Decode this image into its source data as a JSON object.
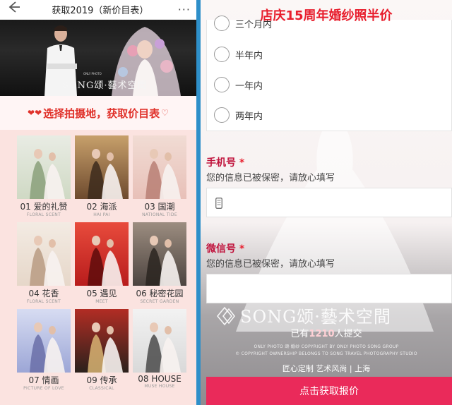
{
  "left": {
    "topbar": {
      "back_icon": "back-arrow-icon",
      "title": "获取2019（新价目表）",
      "more_icon": "more-dots-icon",
      "more_glyph": "···"
    },
    "banner": {
      "brand": "SONG颂·藝术空間",
      "brand_small": "ONLY PHOTO"
    },
    "headline": {
      "text": "选择拍摄地，获取价目表",
      "left_icon": "double-heart-icon",
      "right_icon": "heart-icon"
    },
    "locations": [
      {
        "num": "01",
        "name": "爱的礼赞",
        "en": "FLORAL SCENT",
        "colors": [
          "#cfd9c4",
          "#e9ece4",
          "#8aa07a"
        ]
      },
      {
        "num": "02",
        "name": "海派",
        "en": "HAI PAI",
        "colors": [
          "#6e4a2e",
          "#c7a06b",
          "#3c2a1c"
        ]
      },
      {
        "num": "03",
        "name": "国潮",
        "en": "NATIONAL TIDE",
        "colors": [
          "#e8c0b8",
          "#f1dcd4",
          "#b97f74"
        ]
      },
      {
        "num": "04",
        "name": "花香",
        "en": "FLORAL SCENT",
        "colors": [
          "#e6d7c9",
          "#f3ebe3",
          "#b99b83"
        ]
      },
      {
        "num": "05",
        "name": "遇见",
        "en": "MEET",
        "colors": [
          "#b81c1c",
          "#e84b3c",
          "#5e0c0c"
        ]
      },
      {
        "num": "06",
        "name": "秘密花园",
        "en": "SECRET GARDEN",
        "colors": [
          "#4d4440",
          "#9c8d80",
          "#2a2420"
        ]
      },
      {
        "num": "07",
        "name": "情画",
        "en": "PICTURE OF LOVE",
        "colors": [
          "#9ca6d6",
          "#d7dcf2",
          "#6a6fa8"
        ]
      },
      {
        "num": "09",
        "name": "传承",
        "en": "CLASSICAL",
        "colors": [
          "#2b211c",
          "#b22d24",
          "#d8b473"
        ]
      },
      {
        "num": "08",
        "name": "HOUSE",
        "en": "MUSE HOUSE",
        "colors": [
          "#d9d9d9",
          "#f2f2f2",
          "#4a4a4a"
        ]
      }
    ]
  },
  "right": {
    "promo": "店庆15周年婚纱照半价",
    "options": [
      "三个月内",
      "半年内",
      "一年内",
      "两年内"
    ],
    "phone": {
      "label": "手机号",
      "star": "*",
      "hint": "您的信息已被保密，请放心填写",
      "icon": "phone-icon"
    },
    "wechat": {
      "label": "微信号",
      "star": "*",
      "hint": "您的信息已被保密，请放心填写"
    },
    "watermark": "SONG颂·藝术空間",
    "submitted": {
      "prefix": "已有",
      "count": "1210",
      "suffix": "人提交"
    },
    "fine1": "ONLY PHOTO  颂·婚纱  COPYRIGHT BY ONLY PHOTO SONG GROUP",
    "fine2": "© COPYRIGHT OWNERSHIP BELONGS TO SONG TRAVEL PHOTOGRAPHY STUDIO",
    "tagline": "匠心定制  艺术风尚  |  上海",
    "cta": "点击获取报价"
  },
  "colors": {
    "accent_red": "#e0312a",
    "cta_pink": "#ea2a5a",
    "divider_blue": "#2e8fc9",
    "label_red": "#c0133c"
  }
}
